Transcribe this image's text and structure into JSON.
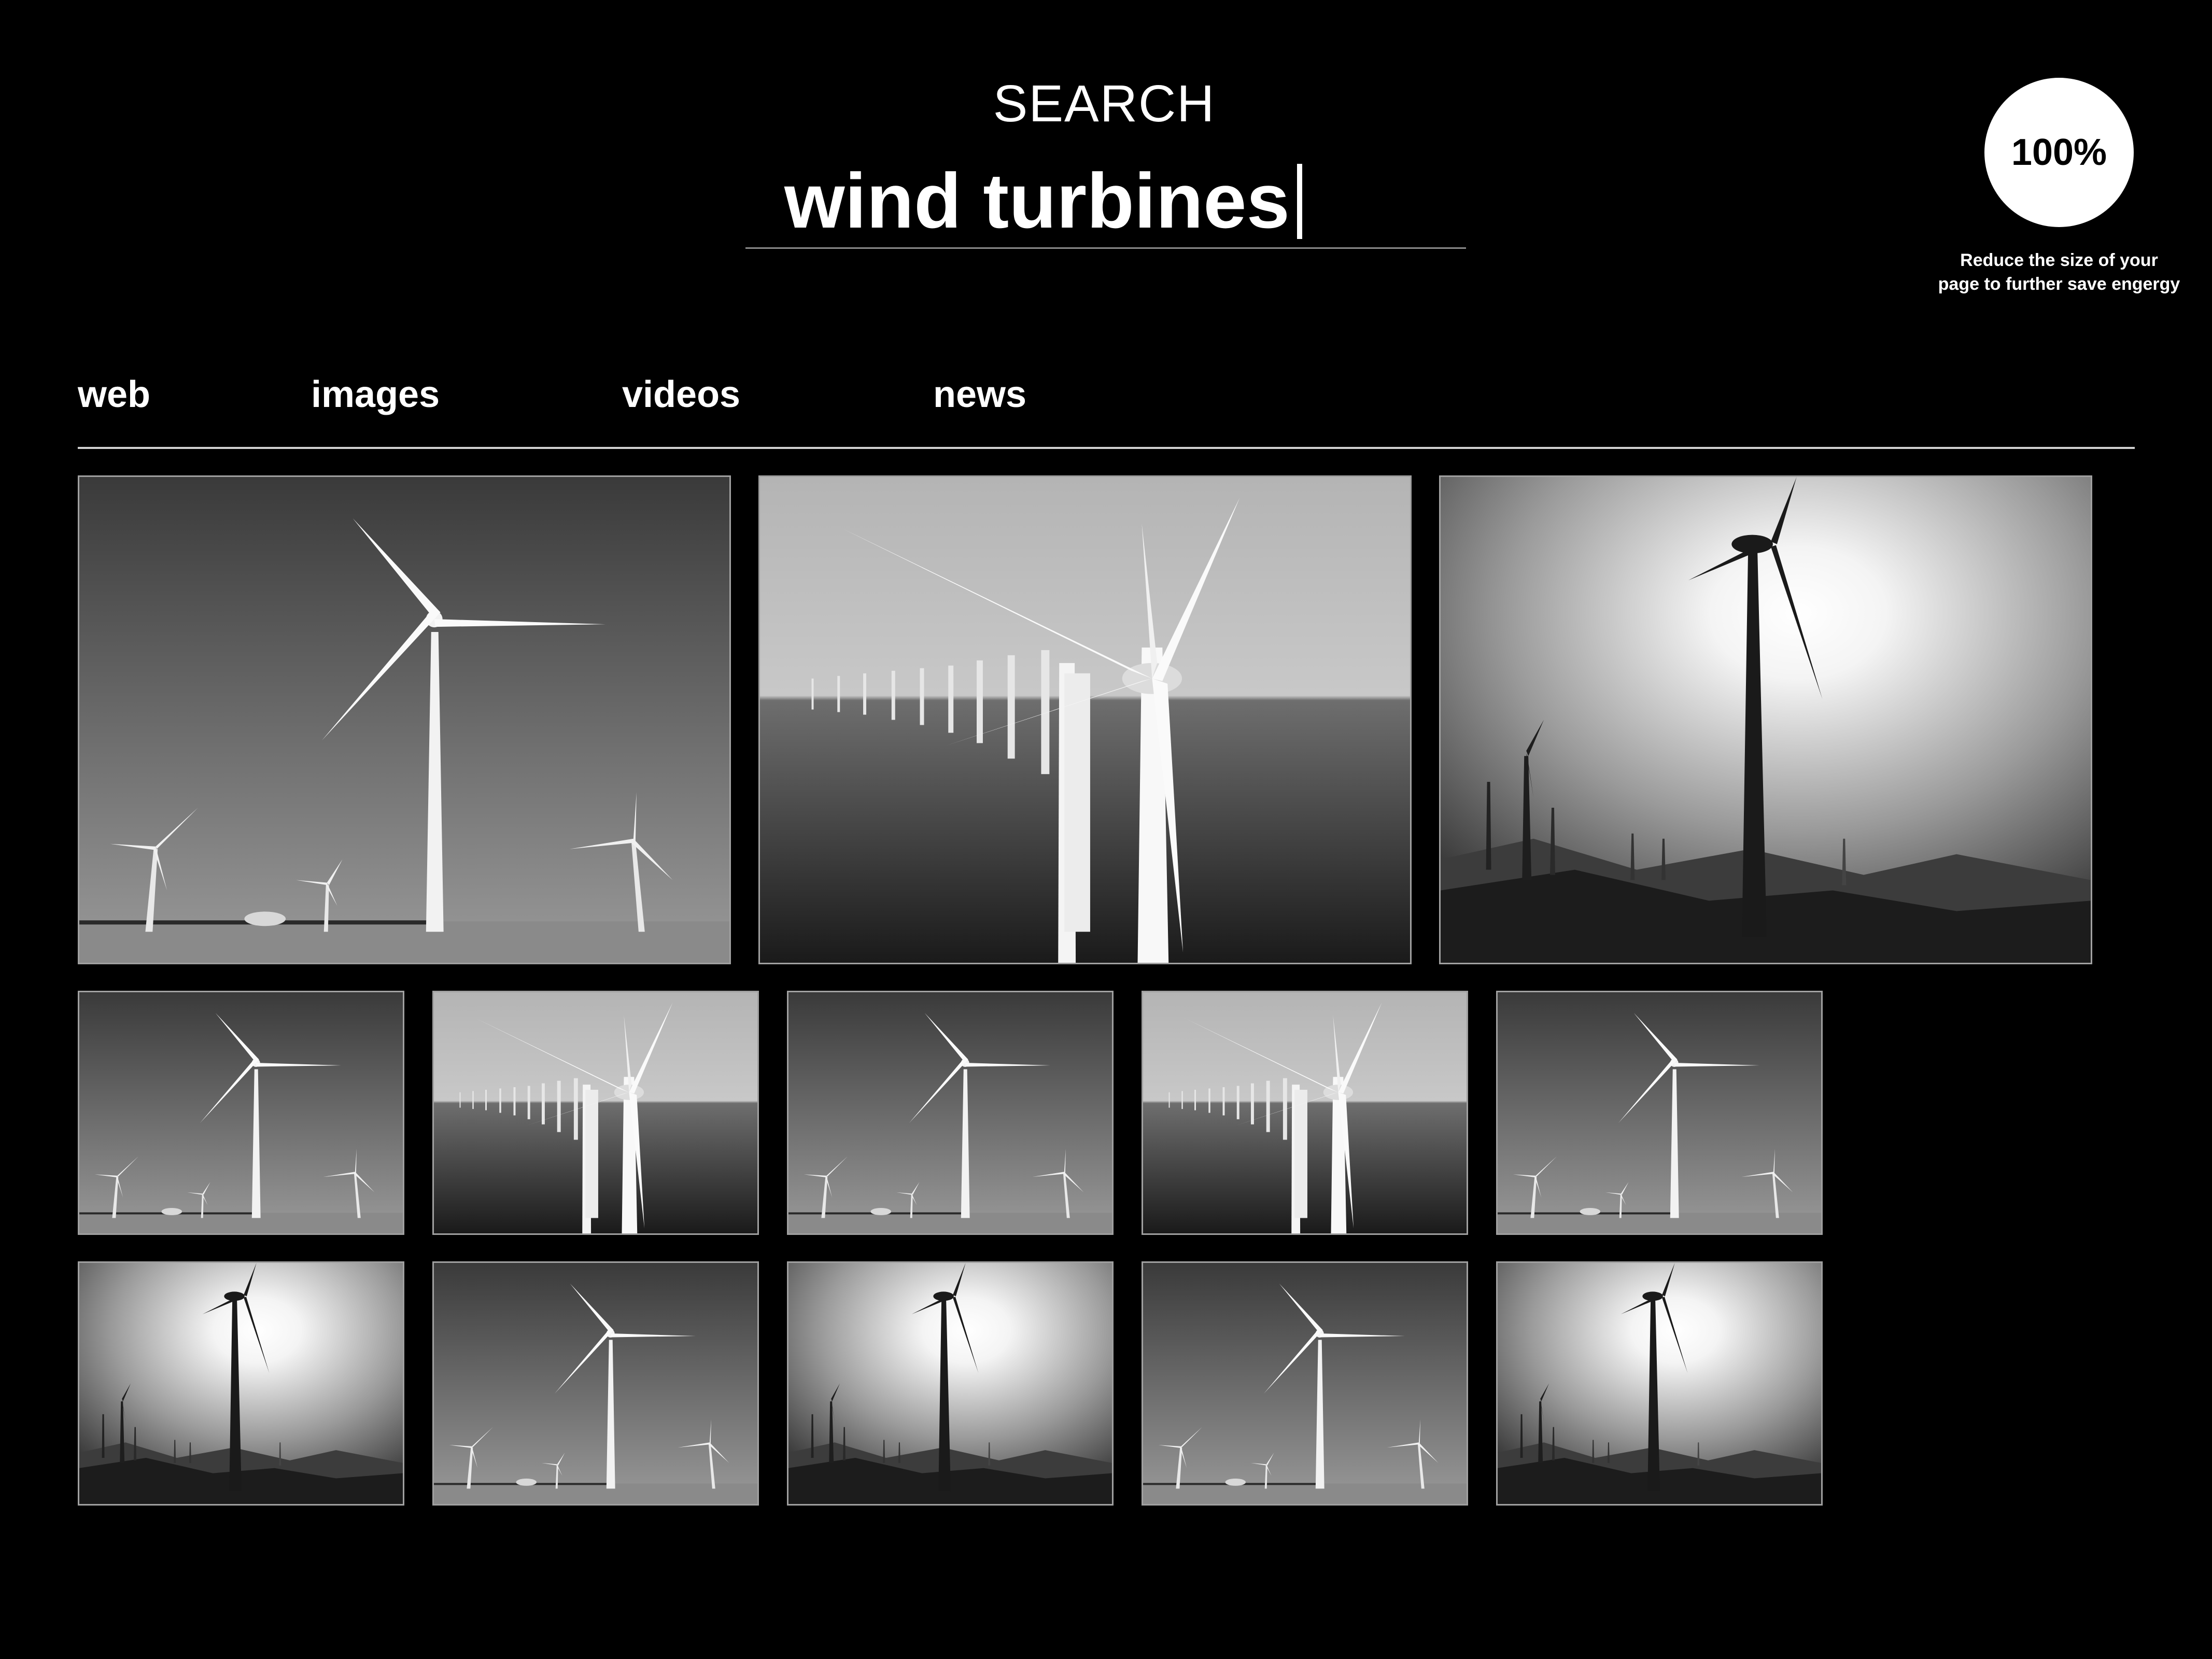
{
  "search": {
    "heading": "SEARCH",
    "query": "wind turbines"
  },
  "energy": {
    "percent": "100%",
    "note": "Reduce the size of your page to further save engergy"
  },
  "tabs": [
    {
      "label": "web"
    },
    {
      "label": "images"
    },
    {
      "label": "videos"
    },
    {
      "label": "news"
    }
  ],
  "colors": {
    "background": "#000000",
    "foreground": "#ffffff",
    "divider": "#d0d0d0"
  },
  "results": {
    "large": [
      "field-turbines",
      "offshore-turbines",
      "hillside-turbines-sun"
    ],
    "small_row_1": [
      "field-turbines",
      "offshore-turbines",
      "field-turbines",
      "offshore-turbines",
      "field-turbines"
    ],
    "small_row_2": [
      "hillside-turbines-sun",
      "field-turbines",
      "hillside-turbines-sun",
      "field-turbines",
      "hillside-turbines-sun"
    ]
  }
}
